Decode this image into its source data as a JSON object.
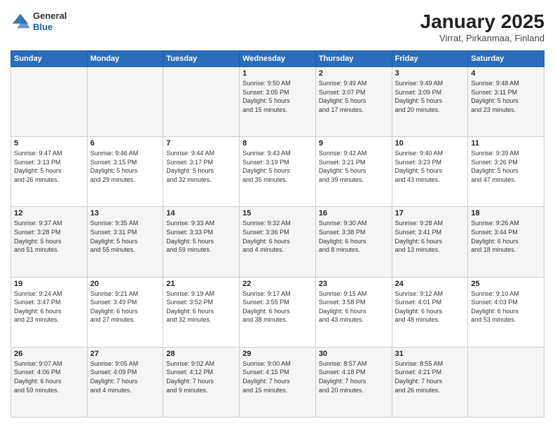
{
  "header": {
    "logo": {
      "general": "General",
      "blue": "Blue"
    },
    "title": "January 2025",
    "subtitle": "Virrat, Pirkanmaa, Finland"
  },
  "days_of_week": [
    "Sunday",
    "Monday",
    "Tuesday",
    "Wednesday",
    "Thursday",
    "Friday",
    "Saturday"
  ],
  "weeks": [
    [
      {
        "day": "",
        "detail": ""
      },
      {
        "day": "",
        "detail": ""
      },
      {
        "day": "",
        "detail": ""
      },
      {
        "day": "1",
        "detail": "Sunrise: 9:50 AM\nSunset: 3:05 PM\nDaylight: 5 hours\nand 15 minutes."
      },
      {
        "day": "2",
        "detail": "Sunrise: 9:49 AM\nSunset: 3:07 PM\nDaylight: 5 hours\nand 17 minutes."
      },
      {
        "day": "3",
        "detail": "Sunrise: 9:49 AM\nSunset: 3:09 PM\nDaylight: 5 hours\nand 20 minutes."
      },
      {
        "day": "4",
        "detail": "Sunrise: 9:48 AM\nSunset: 3:11 PM\nDaylight: 5 hours\nand 23 minutes."
      }
    ],
    [
      {
        "day": "5",
        "detail": "Sunrise: 9:47 AM\nSunset: 3:13 PM\nDaylight: 5 hours\nand 26 minutes."
      },
      {
        "day": "6",
        "detail": "Sunrise: 9:46 AM\nSunset: 3:15 PM\nDaylight: 5 hours\nand 29 minutes."
      },
      {
        "day": "7",
        "detail": "Sunrise: 9:44 AM\nSunset: 3:17 PM\nDaylight: 5 hours\nand 32 minutes."
      },
      {
        "day": "8",
        "detail": "Sunrise: 9:43 AM\nSunset: 3:19 PM\nDaylight: 5 hours\nand 35 minutes."
      },
      {
        "day": "9",
        "detail": "Sunrise: 9:42 AM\nSunset: 3:21 PM\nDaylight: 5 hours\nand 39 minutes."
      },
      {
        "day": "10",
        "detail": "Sunrise: 9:40 AM\nSunset: 3:23 PM\nDaylight: 5 hours\nand 43 minutes."
      },
      {
        "day": "11",
        "detail": "Sunrise: 9:39 AM\nSunset: 3:26 PM\nDaylight: 5 hours\nand 47 minutes."
      }
    ],
    [
      {
        "day": "12",
        "detail": "Sunrise: 9:37 AM\nSunset: 3:28 PM\nDaylight: 5 hours\nand 51 minutes."
      },
      {
        "day": "13",
        "detail": "Sunrise: 9:35 AM\nSunset: 3:31 PM\nDaylight: 5 hours\nand 55 minutes."
      },
      {
        "day": "14",
        "detail": "Sunrise: 9:33 AM\nSunset: 3:33 PM\nDaylight: 5 hours\nand 59 minutes."
      },
      {
        "day": "15",
        "detail": "Sunrise: 9:32 AM\nSunset: 3:36 PM\nDaylight: 6 hours\nand 4 minutes."
      },
      {
        "day": "16",
        "detail": "Sunrise: 9:30 AM\nSunset: 3:38 PM\nDaylight: 6 hours\nand 8 minutes."
      },
      {
        "day": "17",
        "detail": "Sunrise: 9:28 AM\nSunset: 3:41 PM\nDaylight: 6 hours\nand 13 minutes."
      },
      {
        "day": "18",
        "detail": "Sunrise: 9:26 AM\nSunset: 3:44 PM\nDaylight: 6 hours\nand 18 minutes."
      }
    ],
    [
      {
        "day": "19",
        "detail": "Sunrise: 9:24 AM\nSunset: 3:47 PM\nDaylight: 6 hours\nand 23 minutes."
      },
      {
        "day": "20",
        "detail": "Sunrise: 9:21 AM\nSunset: 3:49 PM\nDaylight: 6 hours\nand 27 minutes."
      },
      {
        "day": "21",
        "detail": "Sunrise: 9:19 AM\nSunset: 3:52 PM\nDaylight: 6 hours\nand 32 minutes."
      },
      {
        "day": "22",
        "detail": "Sunrise: 9:17 AM\nSunset: 3:55 PM\nDaylight: 6 hours\nand 38 minutes."
      },
      {
        "day": "23",
        "detail": "Sunrise: 9:15 AM\nSunset: 3:58 PM\nDaylight: 6 hours\nand 43 minutes."
      },
      {
        "day": "24",
        "detail": "Sunrise: 9:12 AM\nSunset: 4:01 PM\nDaylight: 6 hours\nand 48 minutes."
      },
      {
        "day": "25",
        "detail": "Sunrise: 9:10 AM\nSunset: 4:03 PM\nDaylight: 6 hours\nand 53 minutes."
      }
    ],
    [
      {
        "day": "26",
        "detail": "Sunrise: 9:07 AM\nSunset: 4:06 PM\nDaylight: 6 hours\nand 59 minutes."
      },
      {
        "day": "27",
        "detail": "Sunrise: 9:05 AM\nSunset: 4:09 PM\nDaylight: 7 hours\nand 4 minutes."
      },
      {
        "day": "28",
        "detail": "Sunrise: 9:02 AM\nSunset: 4:12 PM\nDaylight: 7 hours\nand 9 minutes."
      },
      {
        "day": "29",
        "detail": "Sunrise: 9:00 AM\nSunset: 4:15 PM\nDaylight: 7 hours\nand 15 minutes."
      },
      {
        "day": "30",
        "detail": "Sunrise: 8:57 AM\nSunset: 4:18 PM\nDaylight: 7 hours\nand 20 minutes."
      },
      {
        "day": "31",
        "detail": "Sunrise: 8:55 AM\nSunset: 4:21 PM\nDaylight: 7 hours\nand 26 minutes."
      },
      {
        "day": "",
        "detail": ""
      }
    ]
  ]
}
